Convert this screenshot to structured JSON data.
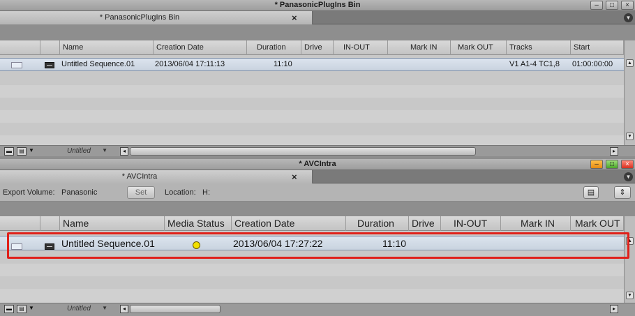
{
  "bin1": {
    "window_title": "* PanasonicPlugIns Bin",
    "tab_label": "* PanasonicPlugIns Bin",
    "tab_close": "×",
    "columns": [
      "Name",
      "Creation Date",
      "Duration",
      "Drive",
      "IN-OUT",
      "Mark IN",
      "Mark OUT",
      "Tracks",
      "Start"
    ],
    "rows": [
      {
        "name": "Untitled Sequence.01",
        "creation_date": "2013/06/04 17:11:13",
        "duration": "11:10",
        "tracks": "V1 A1-4 TC1,8",
        "start": "01:00:00:00"
      }
    ],
    "footer_view": "Untitled"
  },
  "bin2": {
    "window_title": "* AVCIntra",
    "tab_label": "* AVCIntra",
    "tab_close": "×",
    "export_volume_label": "Export Volume:",
    "export_volume_value": "Panasonic",
    "set_button": "Set",
    "location_label": "Location:",
    "location_value": "H:",
    "columns": [
      "Name",
      "Media Status",
      "Creation Date",
      "Duration",
      "Drive",
      "IN-OUT",
      "Mark IN",
      "Mark OUT"
    ],
    "rows": [
      {
        "name": "Untitled Sequence.01",
        "media_status_color": "#f2e000",
        "creation_date": "2013/06/04 17:27:22",
        "duration": "11:10"
      }
    ],
    "footer_view": "Untitled"
  },
  "colors": {
    "highlight": "#e0201a",
    "selected_row": "#d3dce7"
  }
}
